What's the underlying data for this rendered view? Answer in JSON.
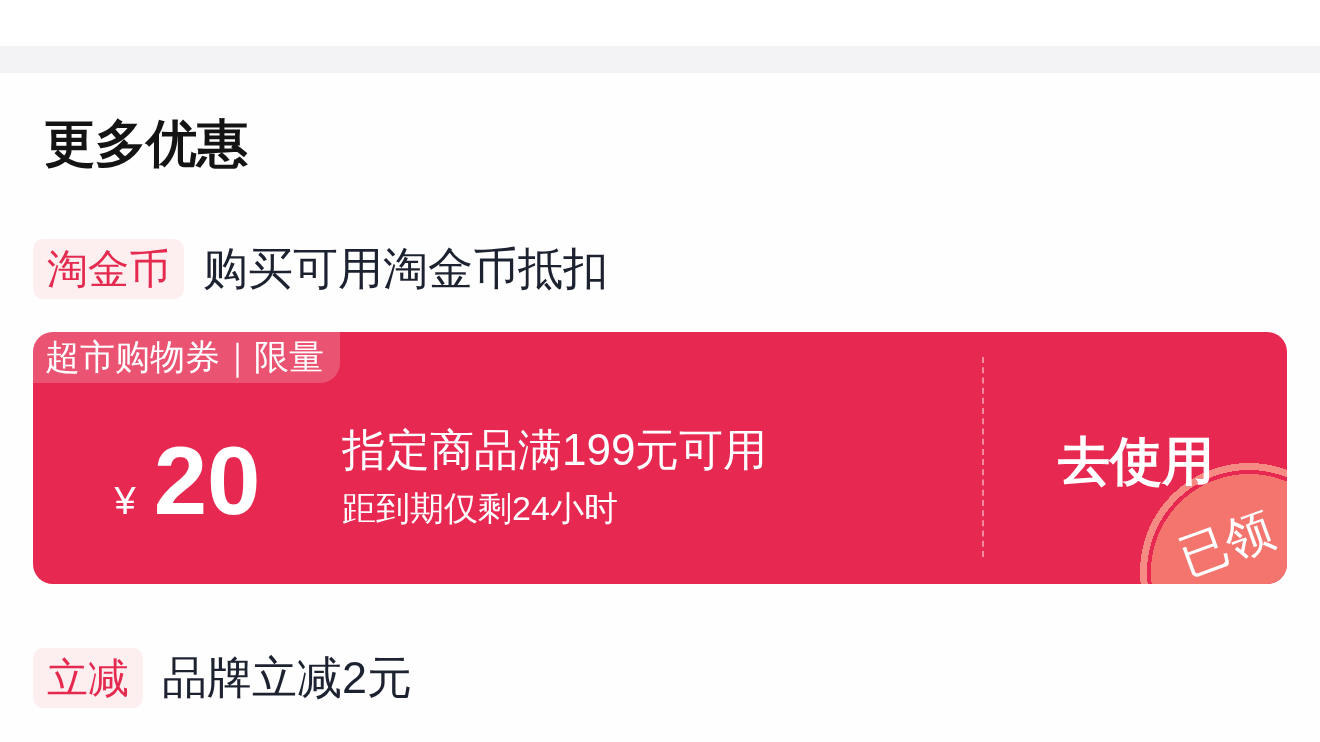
{
  "section_title": "更多优惠",
  "offers": [
    {
      "kind": "tag_line",
      "tag": "淘金币",
      "text": "购买可用淘金币抵扣"
    },
    {
      "kind": "coupon",
      "ribbon": "超市购物券｜限量",
      "currency": "¥",
      "amount": "20",
      "condition": "指定商品满199元可用",
      "expiry": "距到期仅剩24小时",
      "action": "去使用",
      "claimed": true,
      "stamp": "已领"
    },
    {
      "kind": "tag_line",
      "tag": "立减",
      "text": "品牌立减2元"
    }
  ]
}
